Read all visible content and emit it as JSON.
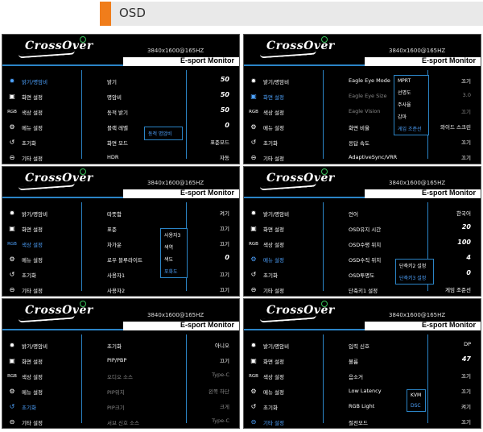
{
  "header": {
    "title": "OSD",
    "accent_color": "#f07d1b"
  },
  "brand": {
    "logo": "CrossOver",
    "resolution": "3840x1600@165HZ",
    "subtitle": "E-sport Monitor"
  },
  "menu": [
    {
      "icon": "brightness-icon",
      "glyph": "✹",
      "label": "밝기/명암비"
    },
    {
      "icon": "image-icon",
      "glyph": "▣",
      "label": "화면 설정"
    },
    {
      "icon": "rgb-icon",
      "glyph": "RGB",
      "label": "색상 설정"
    },
    {
      "icon": "gear-icon",
      "glyph": "⚙",
      "label": "메뉴 설정"
    },
    {
      "icon": "reset-icon",
      "glyph": "↺",
      "label": "초기화"
    },
    {
      "icon": "minus-circle-icon",
      "glyph": "⊖",
      "label": "기타 설정"
    }
  ],
  "panels": [
    {
      "selected": 0,
      "rows": [
        {
          "label": "밝기",
          "value": "50",
          "big": true
        },
        {
          "label": "명암비",
          "value": "50",
          "big": true
        },
        {
          "label": "동적 밝기",
          "value": "50",
          "big": true
        },
        {
          "label": "블랙 레벨",
          "value": "0",
          "big": true
        },
        {
          "label": "화면 모드",
          "value": "표준모드"
        },
        {
          "label": "HDR",
          "value": "자동"
        }
      ],
      "popup": [
        "동적 명암비"
      ]
    },
    {
      "selected": 1,
      "rows": [
        {
          "label": "Eagle Eye Mode",
          "value": "끄기"
        },
        {
          "label": "Eagle Eye Size",
          "value": "3.0",
          "dim": true
        },
        {
          "label": "Eagle Vision",
          "value": "끄기",
          "dim": true
        },
        {
          "label": "화면 비율",
          "value": "와이드 스크린"
        },
        {
          "label": "응답 속도",
          "value": "끄기"
        },
        {
          "label": "AdaptiveSync/VRR",
          "value": "끄기"
        }
      ],
      "popup": [
        "MPRT",
        "선명도",
        "주사율",
        "감마",
        "게임 조준선"
      ]
    },
    {
      "selected": 2,
      "rows": [
        {
          "label": "따뜻함",
          "value": "켜기"
        },
        {
          "label": "표준",
          "value": "끄기"
        },
        {
          "label": "차가운",
          "value": "끄기"
        },
        {
          "label": "로우 블루라이트",
          "value": "0",
          "big": true
        },
        {
          "label": "사용자1",
          "value": "끄기"
        },
        {
          "label": "사용자2",
          "value": "끄기"
        }
      ],
      "popup": [
        "사용자3",
        "색역",
        "색도",
        "포화도"
      ]
    },
    {
      "selected": 3,
      "rows": [
        {
          "label": "언어",
          "value": "한국어"
        },
        {
          "label": "OSD유지 시간",
          "value": "20",
          "big": true
        },
        {
          "label": "OSD수평 위치",
          "value": "100",
          "big": true
        },
        {
          "label": "OSD수직 위치",
          "value": "4",
          "big": true
        },
        {
          "label": "OSD투명도",
          "value": "0",
          "big": true
        },
        {
          "label": "단축키1 설정",
          "value": "게임 조준선"
        }
      ],
      "popup": [
        "단축키2 설정",
        "단축키3 설정"
      ]
    },
    {
      "selected": 4,
      "rows": [
        {
          "label": "초기화",
          "value": "아니오"
        },
        {
          "label": "PIP/PBP",
          "value": "끄기"
        },
        {
          "label": "오디오 소스",
          "value": "Type-C",
          "dim": true,
          "dimlabel": true
        },
        {
          "label": "PIP위치",
          "value": "왼쪽 하단",
          "dim": true,
          "dimlabel": true
        },
        {
          "label": "PIP크기",
          "value": "크게",
          "dim": true,
          "dimlabel": true
        },
        {
          "label": "서브 신호 소스",
          "value": "Type-C",
          "dim": true,
          "dimlabel": true
        }
      ],
      "popup": []
    },
    {
      "selected": 5,
      "rows": [
        {
          "label": "입력 신호",
          "value": "DP"
        },
        {
          "label": "볼륨",
          "value": "47",
          "big": true
        },
        {
          "label": "음소거",
          "value": "끄기"
        },
        {
          "label": "Low Latency",
          "value": "끄기"
        },
        {
          "label": "RGB Light",
          "value": "켜기"
        },
        {
          "label": "절전모드",
          "value": "끄기"
        }
      ],
      "popup": [
        "KVM",
        "DSC"
      ]
    }
  ]
}
